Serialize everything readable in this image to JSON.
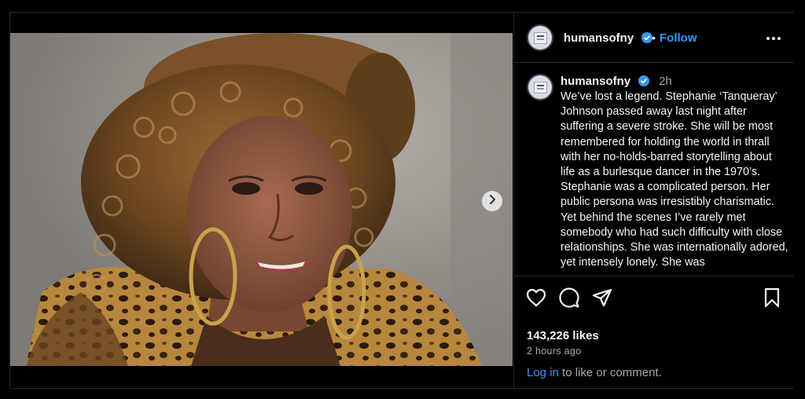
{
  "post": {
    "username": "humansofny",
    "verified": true,
    "separator": "•",
    "follow_label": "Follow",
    "time": "2h",
    "caption": "We’ve lost a legend. Stephanie ‘Tanqueray’ Johnson passed away last night after suffering a severe stroke. She will be most remembered for holding the world in thrall with her no-holds-barred storytelling about life as a burlesque dancer in the 1970’s. Stephanie was a complicated person. Her public persona was irresistibly charismatic. Yet behind the scenes I’ve rarely met somebody who had such difficulty with close relationships. She was internationally adored, yet intensely lonely. She was",
    "likes": "143,226 likes",
    "time_ago": "2 hours ago"
  },
  "login": {
    "link_label": "Log in",
    "suffix": " to like or comment."
  },
  "colors": {
    "accent": "#3897f0",
    "verified_badge": "#3897f0",
    "background": "#000000",
    "secondary_text": "#a8a8a8"
  },
  "icons": [
    "chevron-right-icon",
    "more-options-icon",
    "verified-badge-icon",
    "heart-icon",
    "comment-icon",
    "share-icon",
    "bookmark-icon"
  ]
}
